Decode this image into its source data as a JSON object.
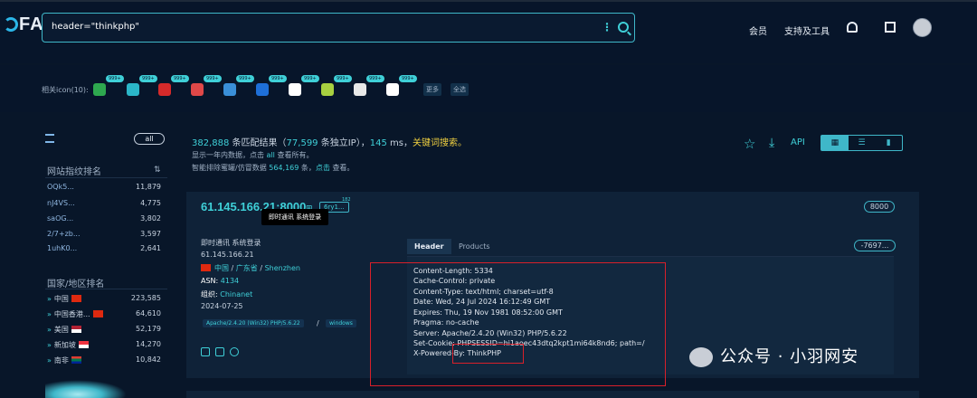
{
  "header": {
    "logo_text": "FA",
    "search_query": "header=\"thinkphp\"",
    "nav": [
      "会员",
      "支持及工具"
    ]
  },
  "icon_bar": {
    "label": "相关icon(10):",
    "icons": [
      {
        "name": "icon-1",
        "count": "999+",
        "color": "#2ea84f"
      },
      {
        "name": "icon-2",
        "count": "999+",
        "color": "#2bb6c8"
      },
      {
        "name": "icon-3",
        "count": "999+",
        "color": "#d62a2a"
      },
      {
        "name": "icon-4",
        "count": "999+",
        "color": "#e04848"
      },
      {
        "name": "icon-5",
        "count": "999+",
        "color": "#3a8fd8"
      },
      {
        "name": "icon-6",
        "count": "999+",
        "color": "#1e6fd8"
      },
      {
        "name": "icon-7",
        "count": "999+",
        "color": "#ffffff"
      },
      {
        "name": "icon-8",
        "count": "999+",
        "color": "#a8d040"
      },
      {
        "name": "icon-9",
        "count": "999+",
        "color": "#e8e8e8"
      },
      {
        "name": "icon-10",
        "count": "999+",
        "color": "#ffffff"
      }
    ],
    "more_label": "更多",
    "select_all_label": "全选"
  },
  "sidebar": {
    "all_label": "all",
    "fingerprint_title": "网站指纹排名",
    "fingerprints": [
      {
        "name": "OQk5...",
        "count": "11,879"
      },
      {
        "name": "nJ4VS...",
        "count": "4,775"
      },
      {
        "name": "saOG...",
        "count": "3,802"
      },
      {
        "name": "2/7+zb...",
        "count": "3,597"
      },
      {
        "name": "1uhK0...",
        "count": "2,641"
      }
    ],
    "country_title": "国家/地区排名",
    "countries": [
      {
        "name": "中国",
        "count": "223,585",
        "flag": "#de2910"
      },
      {
        "name": "中国香港...",
        "count": "64,610",
        "flag": "#de2910"
      },
      {
        "name": "美国",
        "count": "52,179",
        "flag": "#3c3b6e"
      },
      {
        "name": "新加坡",
        "count": "14,270",
        "flag": "#ef3340"
      },
      {
        "name": "南非",
        "count": "10,842",
        "flag": "#007a4d"
      }
    ]
  },
  "results": {
    "total": "382,888",
    "total_suffix": " 条匹配结果（",
    "unique_ip": "77,599",
    "unique_suffix": " 条独立IP），",
    "ms": "145",
    "ms_suffix": " ms，",
    "keyword_search": "关键词搜索。",
    "sub1_pre": "显示一年内数据，点击 ",
    "sub1_link": "all",
    "sub1_post": " 查看所有。",
    "sub2_pre": "智能排除蜜罐/仿冒数据 ",
    "sub2_count": "564,169",
    "sub2_mid": " 条，",
    "sub2_link": "点击",
    "sub2_post": " 查看。",
    "api_label": "API"
  },
  "card": {
    "ip": "61.145.166.21:8000",
    "host_badge": "6ry1...",
    "host_count": "182",
    "tooltip": "即时通讯 系统登录",
    "port": "8000",
    "dash": "-7697...",
    "title": "即时通讯 系统登录",
    "ip_plain": "61.145.166.21",
    "location": [
      "中国",
      "广东省",
      "Shenzhen"
    ],
    "asn_label": "ASN:",
    "asn": "4134",
    "org_label": "组织:",
    "org": "Chinanet",
    "date": "2024-07-25",
    "tags": [
      "Apache/2.4.20 (Win32) PHP/5.6.22",
      "windows"
    ],
    "tabs": [
      "Header",
      "Products"
    ],
    "headers": [
      "Content-Length: 5334",
      "Cache-Control: private",
      "Content-Type: text/html; charset=utf-8",
      "Date: Wed, 24 Jul 2024 16:12:49 GMT",
      "Expires: Thu, 19 Nov 1981 08:52:00 GMT",
      "Pragma: no-cache",
      "Server: Apache/2.4.20 (Win32) PHP/5.6.22",
      "Set-Cookie: PHPSESSID=hi1aoec43dtq2kpt1mi64k8nd6; path=/",
      "X-Powered-By: ThinkPHP"
    ]
  },
  "watermark": "公众号 · 小羽网安",
  "colors": {
    "accent": "#3fd0d8",
    "highlight": "#f0d040",
    "box": "#d8202a"
  }
}
